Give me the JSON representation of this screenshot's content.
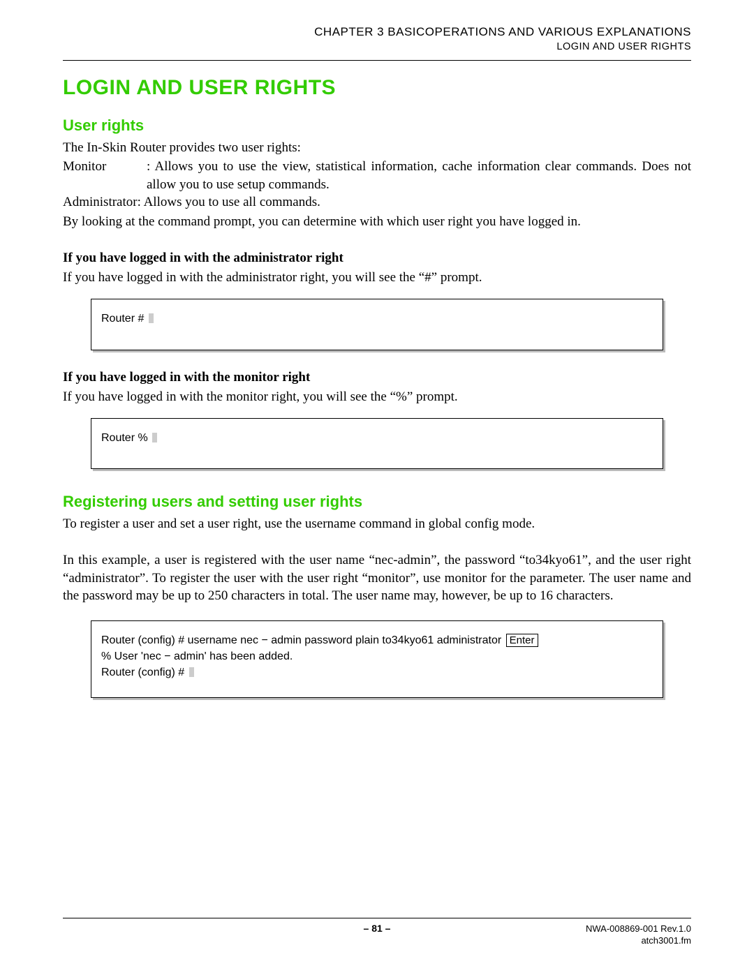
{
  "header": {
    "chapter": "CHAPTER 3   BASICOPERATIONS AND VARIOUS EXPLANATIONS",
    "section": "LOGIN AND USER RIGHTS"
  },
  "title": "LOGIN AND USER RIGHTS",
  "user_rights": {
    "heading": "User rights",
    "intro": "The In-Skin Router provides two user rights:",
    "monitor_label": "Monitor",
    "monitor_text": ": Allows you to use the view, statistical information, cache information clear commands. Does not allow you to use setup commands.",
    "admin_line": "Administrator: Allows you to use all commands.",
    "prompt_note": "By looking at the command prompt, you can determine with which user right you have logged in.",
    "admin_sub": "If you have logged in with the administrator right",
    "admin_desc": "If you have logged in with the administrator right, you will see the “#” prompt.",
    "admin_term": "Router # ",
    "monitor_sub": "If you have logged in with the monitor right",
    "monitor_desc": "If you have logged in with the monitor right, you will see the “%” prompt.",
    "monitor_term": "Router % "
  },
  "registering": {
    "heading": "Registering users and setting user rights",
    "p1": "To register a user and set a user right, use the username command in global config mode.",
    "p2": "In this example, a user is registered with the user name “nec-admin”, the password “to34kyo61”, and the user right “administrator”. To register the user with the user right “monitor”, use monitor for the parameter. The user name and the password may be up to 250 characters in total. The user name may, however, be up to 16 characters.",
    "term_line1_pre": "Router (config) # username nec − admin password plain to34kyo61 administrator ",
    "term_enter": "Enter",
    "term_line2": "% User 'nec − admin' has been added.",
    "term_line3": "Router (config) # "
  },
  "footer": {
    "page": "– 81 –",
    "docid": "NWA-008869-001 Rev.1.0",
    "file": "atch3001.fm"
  }
}
